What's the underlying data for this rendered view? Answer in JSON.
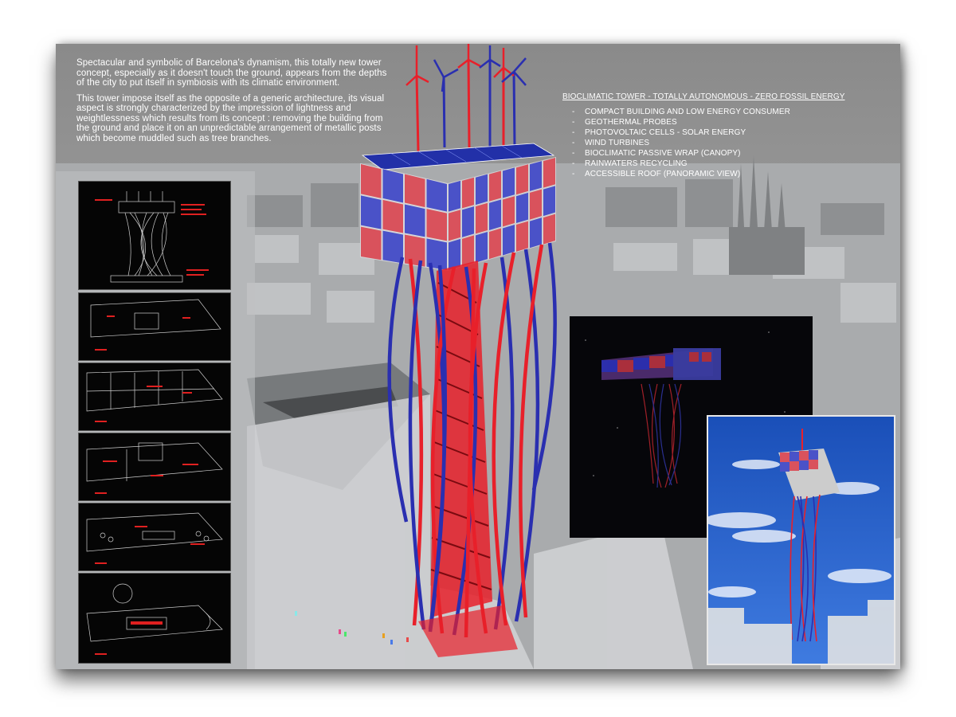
{
  "intro": {
    "paragraph1": "Spectacular and symbolic of Barcelona's dynamism, this totally new tower concept, especially as it doesn't touch the ground, appears from the depths of the city to put itself in symbiosis with its climatic environment.",
    "paragraph2": "This tower impose itself as the opposite of a generic architecture, its visual aspect is strongly characterized by the impression of lightness and weightlessness which results from its concept : removing the building from the ground and place it on an unpredictable arrangement of metallic posts which become muddled such as tree branches."
  },
  "features": {
    "title": "BIOCLIMATIC TOWER - TOTALLY AUTONOMOUS - ZERO FOSSIL ENERGY",
    "items": [
      "COMPACT BUILDING AND LOW ENERGY CONSUMER",
      "GEOTHERMAL PROBES",
      "PHOTOVOLTAIC CELLS - SOLAR ENERGY",
      "WIND TURBINES",
      "BIOCLIMATIC PASSIVE WRAP (CANOPY)",
      "RAINWATERS RECYCLING",
      "ACCESSIBLE ROOF (PANORAMIC VIEW)"
    ]
  },
  "colors": {
    "tower_red": "#e8202a",
    "tower_blue": "#2a2fb0",
    "panel_red": "#d9525c",
    "panel_blue": "#4a52c8",
    "plan_line": "#cfcfcf",
    "plan_accent": "#e02020"
  },
  "drawings": [
    "section-drawing",
    "roof-plan",
    "floor-plan-upper",
    "floor-plan-mid",
    "floor-plan-lower",
    "ground-plan"
  ]
}
